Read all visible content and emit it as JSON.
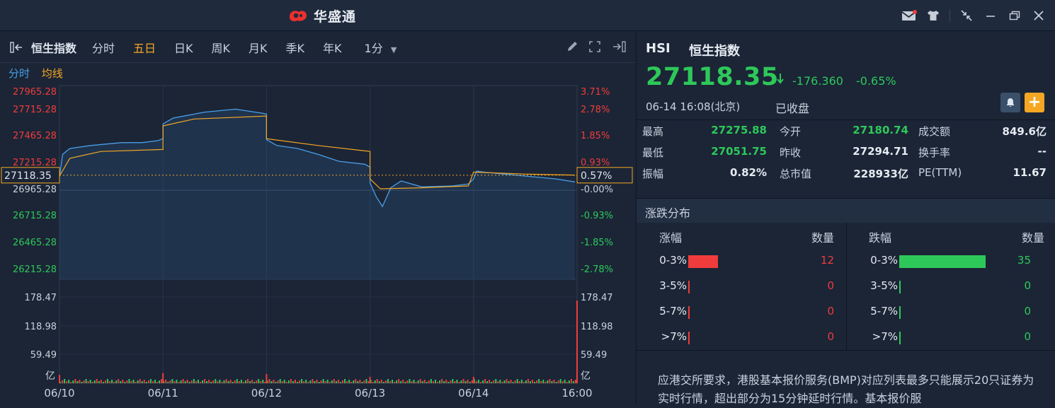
{
  "app": {
    "title": "华盛通"
  },
  "toolbar": {
    "index_name": "恒生指数",
    "tabs": [
      "分时",
      "五日",
      "日K",
      "周K",
      "月K",
      "季K",
      "年K"
    ],
    "active_tab": "五日",
    "interval": "1分"
  },
  "chart_tabs": {
    "tab1": "分时",
    "tab2": "均线"
  },
  "chart_data": {
    "type": "line",
    "x_labels": [
      "06/10",
      "06/11",
      "06/12",
      "06/13",
      "06/14",
      "16:00"
    ],
    "price_ticks": [
      "27965.28",
      "27715.28",
      "27465.28",
      "27215.28",
      "26965.28",
      "26715.28",
      "26465.28",
      "26215.28"
    ],
    "pct_ticks": [
      "3.71%",
      "2.78%",
      "1.85%",
      "0.93%",
      "-0.00%",
      "-0.93%",
      "-1.85%",
      "-2.78%"
    ],
    "volume_ticks": [
      "178.47",
      "118.98",
      "59.49"
    ],
    "volume_unit": "亿",
    "current_price_label": "27118.35",
    "current_pct_label": "0.57%",
    "ylim": [
      26060,
      28030
    ],
    "prev_close": 26965.28,
    "price_series": [
      [
        0,
        27100
      ],
      [
        0.03,
        27330
      ],
      [
        0.1,
        27390
      ],
      [
        0.3,
        27420
      ],
      [
        0.6,
        27450
      ],
      [
        0.8,
        27450
      ],
      [
        0.95,
        27470
      ],
      [
        1.0,
        27490
      ],
      [
        1.0,
        27640
      ],
      [
        1.1,
        27700
      ],
      [
        1.4,
        27760
      ],
      [
        1.7,
        27790
      ],
      [
        1.95,
        27750
      ],
      [
        2.0,
        27740
      ],
      [
        2.0,
        27480
      ],
      [
        2.1,
        27420
      ],
      [
        2.3,
        27390
      ],
      [
        2.5,
        27330
      ],
      [
        2.7,
        27260
      ],
      [
        2.95,
        27230
      ],
      [
        3.0,
        27200
      ],
      [
        3.0,
        27040
      ],
      [
        3.06,
        26900
      ],
      [
        3.12,
        26800
      ],
      [
        3.2,
        26990
      ],
      [
        3.3,
        27060
      ],
      [
        3.5,
        27000
      ],
      [
        3.8,
        27010
      ],
      [
        3.95,
        27030
      ],
      [
        4.0,
        27080
      ],
      [
        4.03,
        27160
      ],
      [
        4.1,
        27150
      ],
      [
        4.3,
        27130
      ],
      [
        4.6,
        27100
      ],
      [
        4.8,
        27080
      ],
      [
        4.98,
        27050
      ]
    ],
    "avg_series": [
      [
        0,
        27110
      ],
      [
        0.1,
        27290
      ],
      [
        0.4,
        27360
      ],
      [
        1.0,
        27380
      ],
      [
        1.0,
        27620
      ],
      [
        1.3,
        27690
      ],
      [
        2.0,
        27720
      ],
      [
        2.0,
        27490
      ],
      [
        2.5,
        27420
      ],
      [
        3.0,
        27360
      ],
      [
        3.0,
        27080
      ],
      [
        3.1,
        26980
      ],
      [
        3.5,
        26990
      ],
      [
        3.95,
        27010
      ],
      [
        4.0,
        27150
      ],
      [
        4.5,
        27130
      ],
      [
        4.98,
        27120
      ]
    ],
    "volume_ylim": [
      0,
      200
    ],
    "volume_spikes": [
      [
        0,
        18
      ],
      [
        1.0,
        22
      ],
      [
        2.0,
        20
      ],
      [
        3.0,
        14
      ],
      [
        4.0,
        14
      ],
      [
        5.0,
        178.47
      ]
    ]
  },
  "quote": {
    "code": "HSI",
    "name": "恒生指数",
    "price": "27118.35",
    "change": "-176.360",
    "change_pct": "-0.65%",
    "time": "06-14 16:08(北京)",
    "status": "已收盘"
  },
  "stats": [
    {
      "l1": "最高",
      "v1": "27275.88",
      "l2": "今开",
      "v2": "27180.74",
      "l3": "成交额",
      "v3": "849.6亿"
    },
    {
      "l1": "最低",
      "v1": "27051.75",
      "l2": "昨收",
      "v2": "27294.71",
      "l3": "换手率",
      "v3": "--"
    },
    {
      "l1": "振幅",
      "v1": "0.82%",
      "l2": "总市值",
      "v2": "228933亿",
      "l3": "PE(TTM)",
      "v3": "11.67"
    }
  ],
  "distribution": {
    "title": "涨跌分布",
    "headers": {
      "up": "涨幅",
      "count": "数量",
      "down": "跌幅",
      "count2": "数量"
    },
    "rows": [
      {
        "range": "0-3%",
        "up": "12",
        "down": "35",
        "up_frac": 0.34,
        "down_frac": 1.0
      },
      {
        "range": "3-5%",
        "up": "0",
        "down": "0",
        "up_frac": 0,
        "down_frac": 0
      },
      {
        "range": "5-7%",
        "up": "0",
        "down": "0",
        "up_frac": 0,
        "down_frac": 0
      },
      {
        "range": ">7%",
        "up": "0",
        "down": "0",
        "up_frac": 0,
        "down_frac": 0
      }
    ]
  },
  "notice": "应港交所要求，港股基本报价服务(BMP)对应列表最多只能展示20只证券为实时行情，超出部分为15分钟延时行情。基本报价服",
  "colors": {
    "up": "#f03c3c",
    "down": "#2ec85a",
    "accent": "#f5a623",
    "line": "#4a9fe8",
    "bg": "#1b2536"
  }
}
